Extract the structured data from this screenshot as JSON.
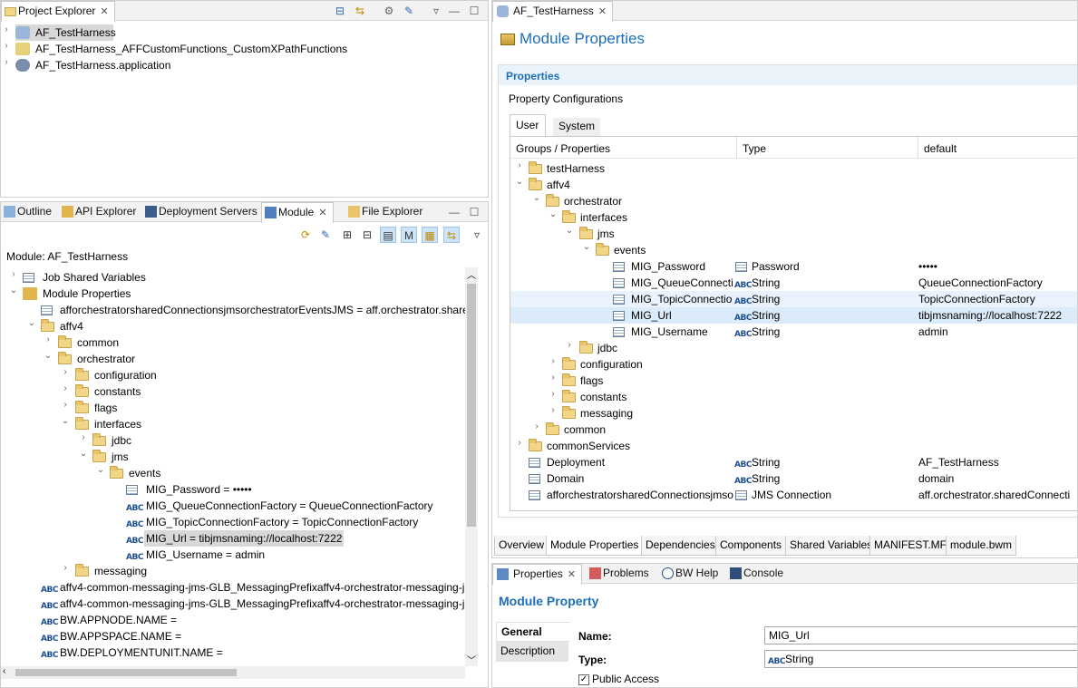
{
  "project_explorer": {
    "title": "Project Explorer",
    "items": [
      {
        "label": "AF_TestHarness"
      },
      {
        "label": "AF_TestHarness_AFFCustomFunctions_CustomXPathFunctions"
      },
      {
        "label": "AF_TestHarness.application"
      }
    ]
  },
  "bottom_left_tabs": [
    {
      "label": "Outline"
    },
    {
      "label": "API Explorer"
    },
    {
      "label": "Deployment Servers"
    },
    {
      "label": "Module"
    },
    {
      "label": "File Explorer"
    }
  ],
  "module_view": {
    "header": "Module: AF_TestHarness",
    "rows": [
      {
        "label": "Job Shared Variables"
      },
      {
        "label": "Module Properties"
      },
      {
        "label": "afforchestratorsharedConnectionsjmsorchestratorEventsJMS = aff.orchestrator.sharedC"
      },
      {
        "label": "affv4"
      },
      {
        "label": "common"
      },
      {
        "label": "orchestrator"
      },
      {
        "label": "configuration"
      },
      {
        "label": "constants"
      },
      {
        "label": "flags"
      },
      {
        "label": "interfaces"
      },
      {
        "label": "jdbc"
      },
      {
        "label": "jms"
      },
      {
        "label": "events"
      },
      {
        "label": "MIG_Password = •••••"
      },
      {
        "label": "MIG_QueueConnectionFactory = QueueConnectionFactory"
      },
      {
        "label": "MIG_TopicConnectionFactory = TopicConnectionFactory"
      },
      {
        "label": "MIG_Url = tibjmsnaming://localhost:7222"
      },
      {
        "label": "MIG_Username = admin"
      },
      {
        "label": "messaging"
      },
      {
        "label": "affv4-common-messaging-jms-GLB_MessagingPrefixaffv4-orchestrator-messaging-j"
      },
      {
        "label": "affv4-common-messaging-jms-GLB_MessagingPrefixaffv4-orchestrator-messaging-j"
      },
      {
        "label": "BW.APPNODE.NAME ="
      },
      {
        "label": "BW.APPSPACE.NAME ="
      },
      {
        "label": "BW.DEPLOYMENTUNIT.NAME ="
      }
    ]
  },
  "editor": {
    "tab_label": "AF_TestHarness",
    "title": "Module Properties",
    "section_title": "Properties",
    "subtitle": "Property Configurations",
    "inner_tabs": [
      {
        "label": "User"
      },
      {
        "label": "System"
      }
    ],
    "columns": [
      "Groups / Properties",
      "Type",
      "default"
    ],
    "rows": [
      {
        "name": "testHarness",
        "type": "",
        "default": ""
      },
      {
        "name": "affv4",
        "type": "",
        "default": ""
      },
      {
        "name": "orchestrator",
        "type": "",
        "default": ""
      },
      {
        "name": "interfaces",
        "type": "",
        "default": ""
      },
      {
        "name": "jms",
        "type": "",
        "default": ""
      },
      {
        "name": "events",
        "type": "",
        "default": ""
      },
      {
        "name": "MIG_Password",
        "type": "Password",
        "default": "•••••"
      },
      {
        "name": "MIG_QueueConnectio",
        "type": "String",
        "default": "QueueConnectionFactory"
      },
      {
        "name": "MIG_TopicConnectio",
        "type": "String",
        "default": "TopicConnectionFactory"
      },
      {
        "name": "MIG_Url",
        "type": "String",
        "default": "tibjmsnaming://localhost:7222"
      },
      {
        "name": "MIG_Username",
        "type": "String",
        "default": "admin"
      },
      {
        "name": "jdbc",
        "type": "",
        "default": ""
      },
      {
        "name": "configuration",
        "type": "",
        "default": ""
      },
      {
        "name": "flags",
        "type": "",
        "default": ""
      },
      {
        "name": "constants",
        "type": "",
        "default": ""
      },
      {
        "name": "messaging",
        "type": "",
        "default": ""
      },
      {
        "name": "common",
        "type": "",
        "default": ""
      },
      {
        "name": "commonServices",
        "type": "",
        "default": ""
      },
      {
        "name": "Deployment",
        "type": "String",
        "default": "AF_TestHarness"
      },
      {
        "name": "Domain",
        "type": "String",
        "default": "domain"
      },
      {
        "name": "afforchestratorsharedConnectionsjmso",
        "type": "JMS Connection",
        "default": "aff.orchestrator.sharedConnecti"
      }
    ],
    "bottom_tabs": [
      {
        "label": "Overview"
      },
      {
        "label": "Module Properties"
      },
      {
        "label": "Dependencies"
      },
      {
        "label": "Components"
      },
      {
        "label": "Shared Variables"
      },
      {
        "label": "MANIFEST.MF"
      },
      {
        "label": "module.bwm"
      }
    ]
  },
  "properties_view": {
    "tabs": [
      {
        "label": "Properties"
      },
      {
        "label": "Problems"
      },
      {
        "label": "BW Help"
      },
      {
        "label": "Console"
      }
    ],
    "title": "Module Property",
    "side_tabs": [
      {
        "label": "General"
      },
      {
        "label": "Description"
      }
    ],
    "name_label": "Name:",
    "name_value": "MIG_Url",
    "type_label": "Type:",
    "type_value": "String",
    "public_access_label": "Public Access",
    "public_access_checked": true
  }
}
